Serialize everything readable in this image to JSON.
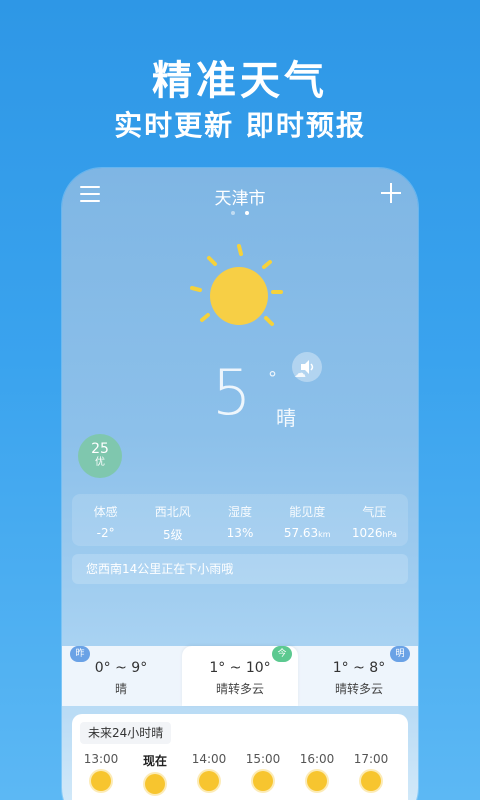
{
  "promo": {
    "title": "精准天气",
    "subtitle": "实时更新 即时预报"
  },
  "header": {
    "city": "天津市"
  },
  "current": {
    "temperature": "5",
    "degree_symbol": "°",
    "condition": "晴",
    "aqi_value": "25",
    "aqi_level": "优"
  },
  "stats": [
    {
      "label": "体感",
      "value": "-2°",
      "unit": ""
    },
    {
      "label": "西北风",
      "value": "5级",
      "unit": ""
    },
    {
      "label": "湿度",
      "value": "13%",
      "unit": ""
    },
    {
      "label": "能见度",
      "value": "57.63",
      "unit": "km"
    },
    {
      "label": "气压",
      "value": "1026",
      "unit": "hPa"
    }
  ],
  "alert": "您西南14公里正在下小雨哦",
  "days": [
    {
      "tag": "昨",
      "range": "0° ~ 9°",
      "condition": "晴"
    },
    {
      "tag": "今",
      "range": "1° ~ 10°",
      "condition": "晴转多云"
    },
    {
      "tag": "明",
      "range": "1° ~ 8°",
      "condition": "晴转多云"
    }
  ],
  "hourly": {
    "title": "未来24小时晴",
    "hours": [
      "13:00",
      "现在",
      "14:00",
      "15:00",
      "16:00",
      "17:00"
    ]
  },
  "colors": {
    "background": "#2e97e6",
    "sun": "#f7c52f",
    "aqi_badge": "#7fc7ae",
    "tag_yesterday": "#6aa2e6",
    "tag_today": "#5cc990",
    "tag_tomorrow": "#6aa2e6"
  },
  "icons": [
    "menu-icon",
    "add-icon",
    "sun-icon",
    "speaker-icon",
    "cloud-icon"
  ]
}
